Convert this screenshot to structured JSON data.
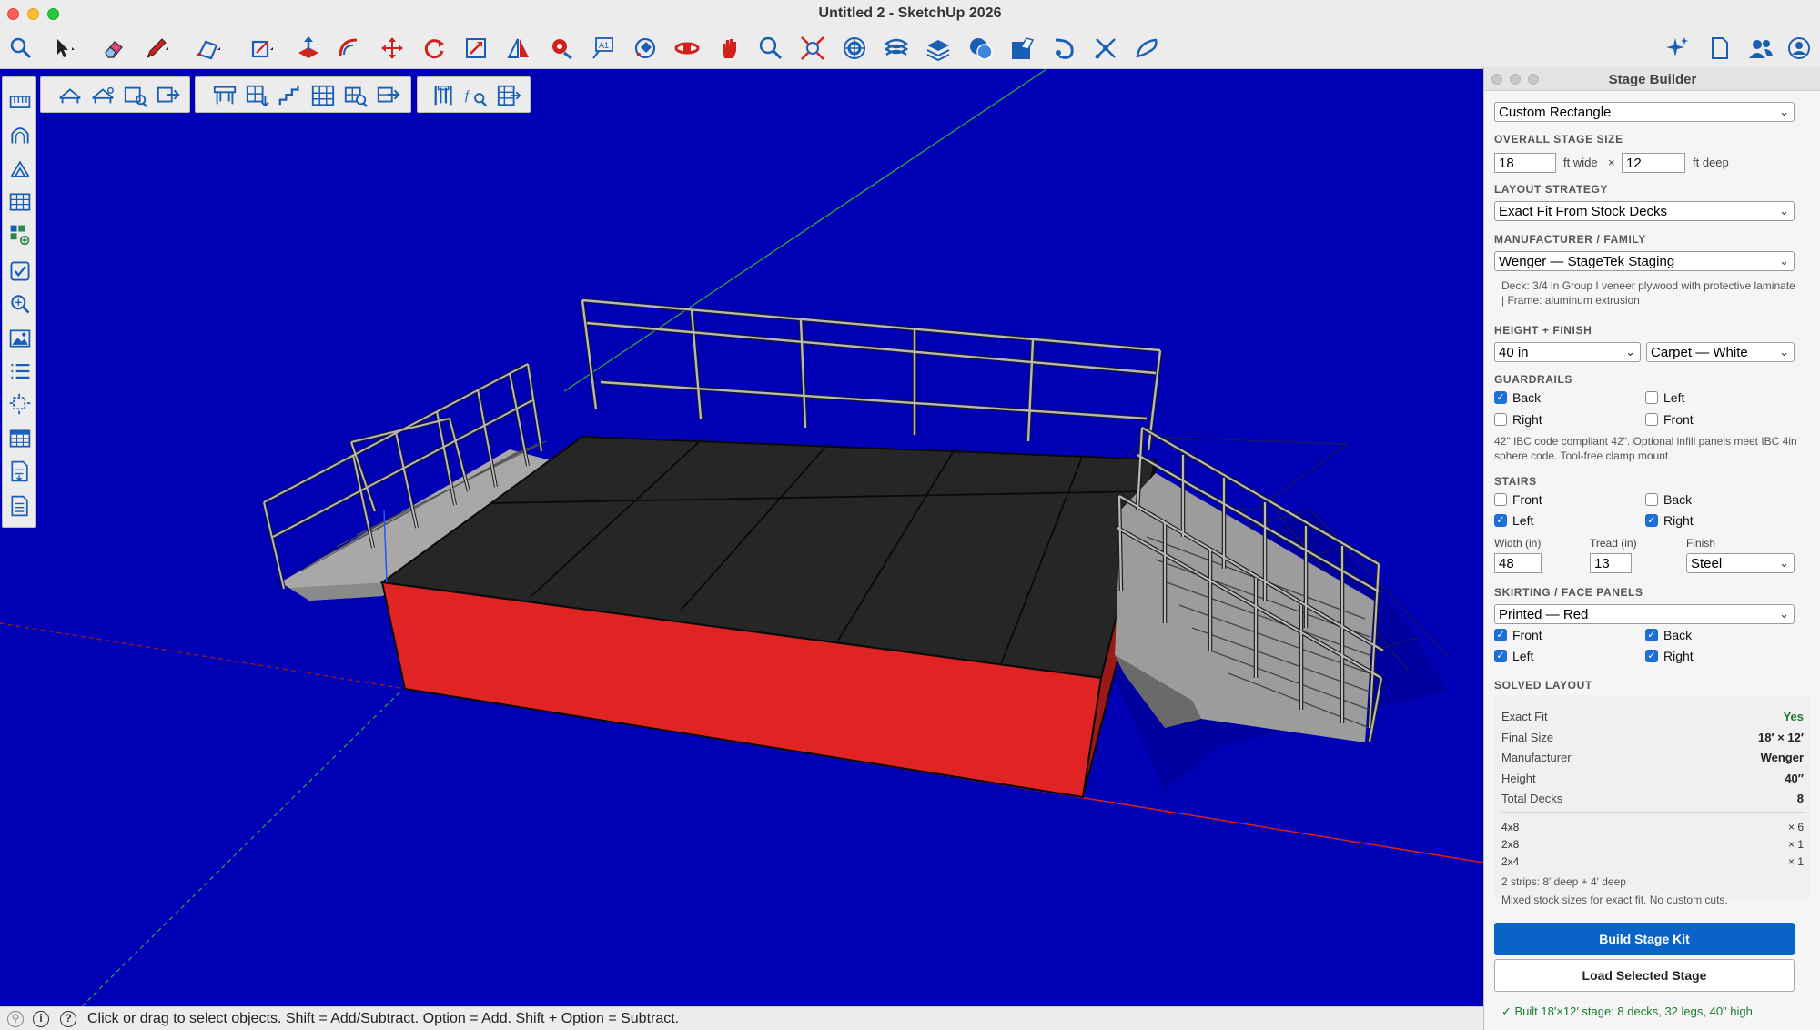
{
  "window": {
    "title": "Untitled 2 - SketchUp 2026"
  },
  "colors": {
    "viewport_bg": "#0000b4",
    "deck": "#262626",
    "skirt": "#e02424",
    "accent_blue": "#0a64c8",
    "green": "#1b7a2e"
  },
  "main_toolbar": {
    "icons": [
      "search-icon",
      "select-arrow-icon",
      "eraser-icon",
      "pencil-icon",
      "line-tool-icon",
      "rectangle-icon",
      "push-pull-icon",
      "follow-me-icon",
      "move-icon",
      "rotate-icon",
      "scale-icon",
      "flip-icon",
      "paint-bucket-icon",
      "text-icon",
      "orbit-icon",
      "section-plane-icon",
      "pan-icon",
      "zoom-icon",
      "zoom-extents-icon",
      "styles-icon",
      "layers-icon",
      "outliner-icon",
      "warehouse-icon",
      "extension-warehouse-icon",
      "sandbox-icon",
      "solid-tools-icon",
      "scenes-icon",
      "ai-sparkle-icon",
      "document-icon",
      "profile-icon",
      "account-icon"
    ]
  },
  "status": {
    "text": "Click or drag to select objects. Shift = Add/Subtract. Option = Add. Shift + Option = Subtract."
  },
  "panel": {
    "title": "Stage Builder",
    "stage_type_select": "Custom Rectangle",
    "overall_size_label": "OVERALL STAGE SIZE",
    "width_value": "18",
    "width_unit": "ft wide",
    "times": "×",
    "depth_value": "12",
    "depth_unit": "ft deep",
    "layout_label": "LAYOUT STRATEGY",
    "layout_select": "Exact Fit From Stock Decks",
    "manufacturer_label": "MANUFACTURER / FAMILY",
    "manufacturer_select": "Wenger — StageTek Staging",
    "manufacturer_note": "Deck: 3/4 in Group I veneer plywood with protective laminate | Frame: aluminum extrusion",
    "height_label": "HEIGHT + FINISH",
    "height_select": "40 in",
    "finish_select": "Carpet — White",
    "guardrails_label": "GUARDRAILS",
    "guardrails": {
      "back": "Back",
      "left": "Left",
      "right": "Right",
      "front": "Front"
    },
    "guardrails_note": "42\" IBC code compliant 42\". Optional infill panels meet IBC 4in sphere code. Tool-free clamp mount.",
    "stairs_label": "STAIRS",
    "stairs": {
      "front": "Front",
      "back": "Back",
      "left": "Left",
      "right": "Right"
    },
    "stair_width_label": "Width (in)",
    "stair_tread_label": "Tread (in)",
    "stair_finish_label": "Finish",
    "stair_width": "48",
    "stair_tread": "13",
    "stair_finish": "Steel",
    "skirting_label": "SKIRTING / FACE PANELS",
    "skirting_select": "Printed — Red",
    "skirting": {
      "front": "Front",
      "back": "Back",
      "left": "Left",
      "right": "Right"
    },
    "solved_label": "SOLVED LAYOUT",
    "solved": {
      "exact_fit_label": "Exact Fit",
      "exact_fit": "Yes",
      "final_size_label": "Final Size",
      "final_size": "18′ × 12′",
      "manufacturer_label": "Manufacturer",
      "manufacturer": "Wenger",
      "height_label": "Height",
      "height": "40″",
      "total_decks_label": "Total Decks",
      "total_decks": "8"
    },
    "decks": [
      {
        "size": "4x8",
        "count": "× 6"
      },
      {
        "size": "2x8",
        "count": "× 1"
      },
      {
        "size": "2x4",
        "count": "× 1"
      }
    ],
    "strips_note": "2 strips: 8′ deep + 4′ deep",
    "mixed_note": "Mixed stock sizes for exact fit. No custom cuts.",
    "build_button": "Build Stage Kit",
    "load_button": "Load Selected Stage",
    "built_message": "✓ Built 18′×12′ stage: 8 decks, 32 legs, 40\" high"
  }
}
